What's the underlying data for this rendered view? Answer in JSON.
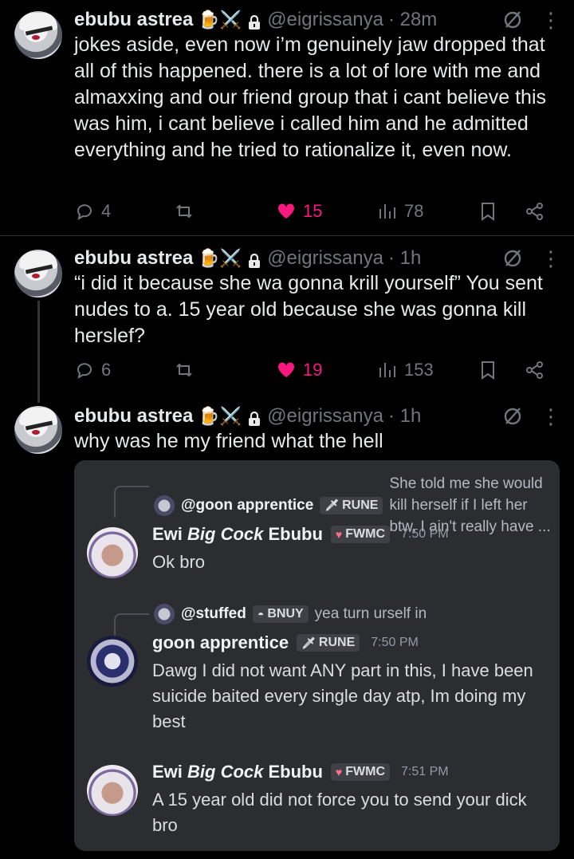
{
  "colors": {
    "background": "#000000",
    "like": "#f91880",
    "muted": "#71767b",
    "card": "#2b2d31"
  },
  "tweets": [
    {
      "display_name": "ebubu astrea",
      "emoji": "🍺⚔️",
      "handle": "@eigrissanya",
      "time": "· 28m",
      "text": "jokes aside, even now i’m genuinely jaw dropped that all of this happened. there is a lot of lore with me and almaxxing and our friend group that i cant believe this was him, i cant believe i called him and he admitted everything and he tried to rationalize it, even now.",
      "replies": "4",
      "likes": "15",
      "views": "78"
    },
    {
      "display_name": "ebubu astrea",
      "emoji": "🍺⚔️",
      "handle": "@eigrissanya",
      "time": "· 1h",
      "text": "“i did it because she wa gonna krill yourself” You sent nudes to a. 15 year old because she was gonna kill herslef?",
      "replies": "6",
      "likes": "19",
      "views": "153"
    },
    {
      "display_name": "ebubu astrea",
      "emoji": "🍺⚔️",
      "handle": "@eigrissanya",
      "time": "· 1h",
      "text": "why was he my friend what the hell"
    }
  ],
  "discord": {
    "reply1": {
      "name": "@goon apprentice",
      "tag": "RUNE",
      "tag_icon": "sword-icon",
      "text": "She told me she would kill herself if I left her btw, I ain't really have ..."
    },
    "msg1": {
      "name_pre": "Ewi ",
      "name_mid": "Big Cock",
      "name_post": " Ebubu",
      "tag": "FWMC",
      "tag_icon": "heart-icon",
      "time": "7:50 PM",
      "text": "Ok bro"
    },
    "reply2": {
      "name": "@stuffed",
      "tag": "BNUY",
      "tag_icon": "bunny-icon",
      "text": "yea turn urself in"
    },
    "msg2": {
      "name": "goon apprentice",
      "tag": "RUNE",
      "tag_icon": "sword-icon",
      "time": "7:50 PM",
      "text": "Dawg I did not want ANY part in this, I have been suicide baited every single day atp, Im doing my best"
    },
    "msg3": {
      "name_pre": "Ewi ",
      "name_mid": "Big Cock",
      "name_post": " Ebubu",
      "tag": "FWMC",
      "tag_icon": "heart-icon",
      "time": "7:51 PM",
      "text": "A 15 year old did not force you to send your dick bro"
    }
  }
}
